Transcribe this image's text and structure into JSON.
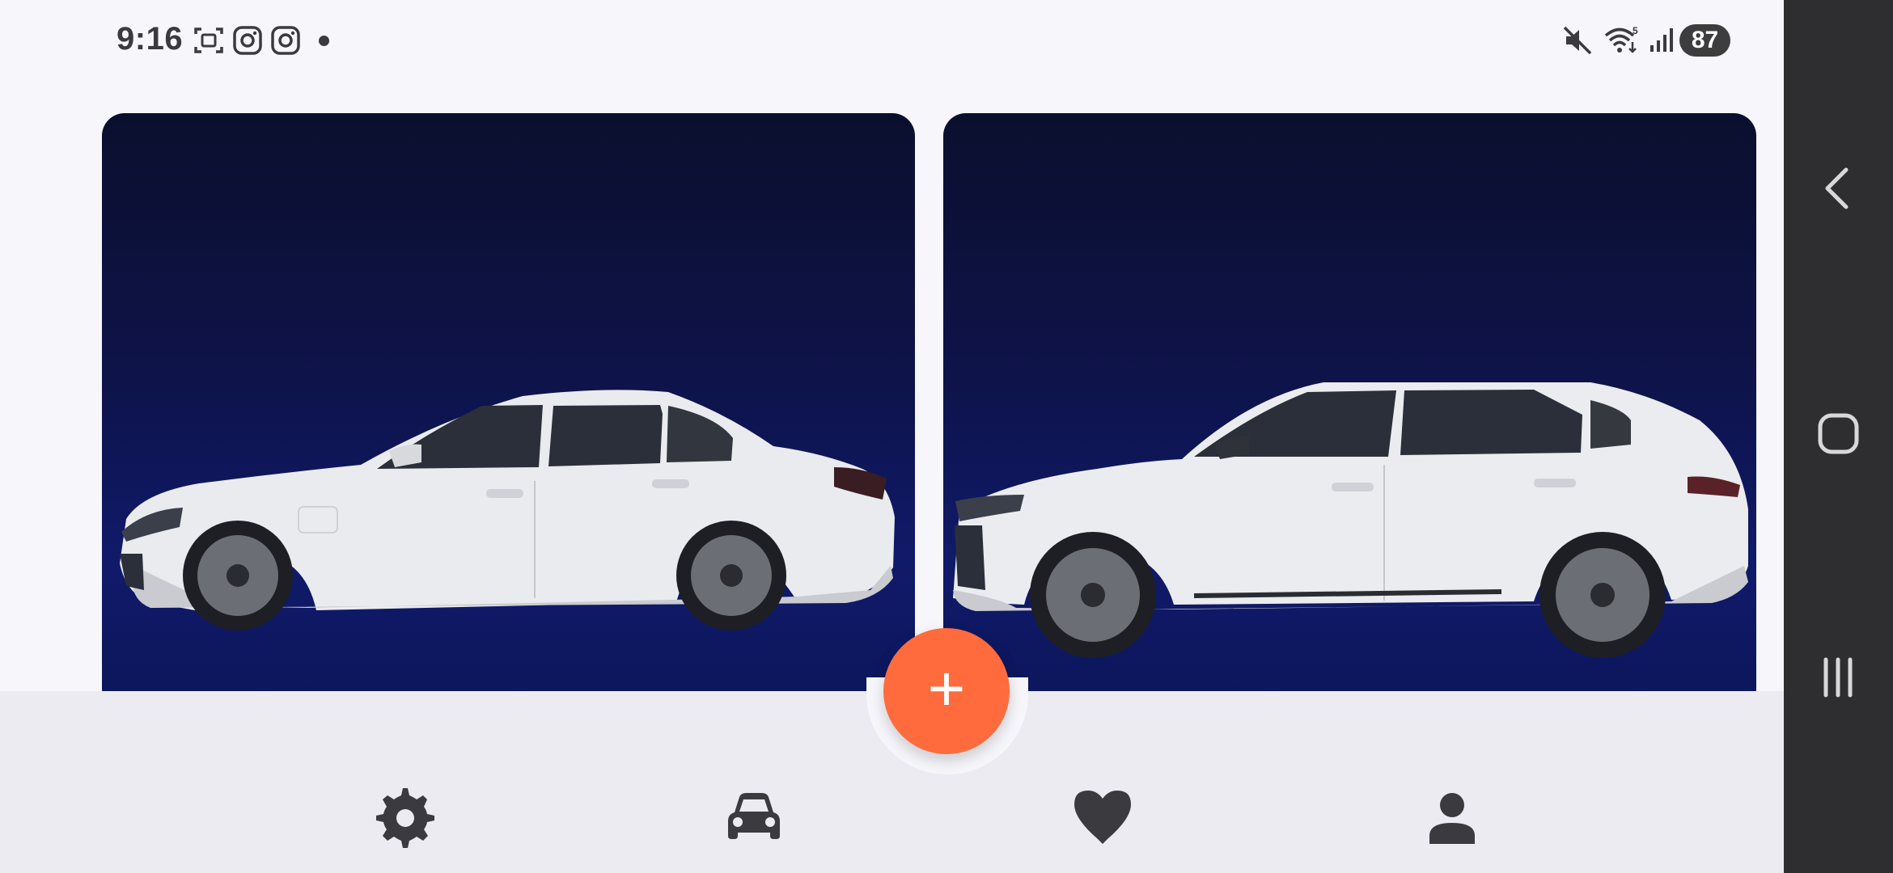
{
  "status_bar": {
    "time": "9:16",
    "battery": "87",
    "icons": [
      "screenshot-icon",
      "instagram-icon",
      "instagram-icon",
      "notification-dot",
      "mute-icon",
      "wifi-icon",
      "signal-icon",
      "battery-icon"
    ]
  },
  "cards": [
    {
      "name": "bmw-sedan-card",
      "image": "white-sedan-side-view"
    },
    {
      "name": "audi-suv-card",
      "image": "white-suv-side-view"
    }
  ],
  "fab": {
    "label": "+",
    "icon": "plus-icon",
    "color": "#ff6b3d"
  },
  "bottom_nav": {
    "items": [
      {
        "icon": "gear-icon"
      },
      {
        "icon": "car-icon"
      },
      {
        "icon": "heart-icon"
      },
      {
        "icon": "person-icon"
      }
    ]
  },
  "system_nav": {
    "buttons": [
      "back-icon",
      "home-icon",
      "recents-icon"
    ]
  },
  "colors": {
    "accent": "#ff6b3d",
    "card_bg": "#0e134a",
    "nav_icon": "#3b3b3f"
  }
}
